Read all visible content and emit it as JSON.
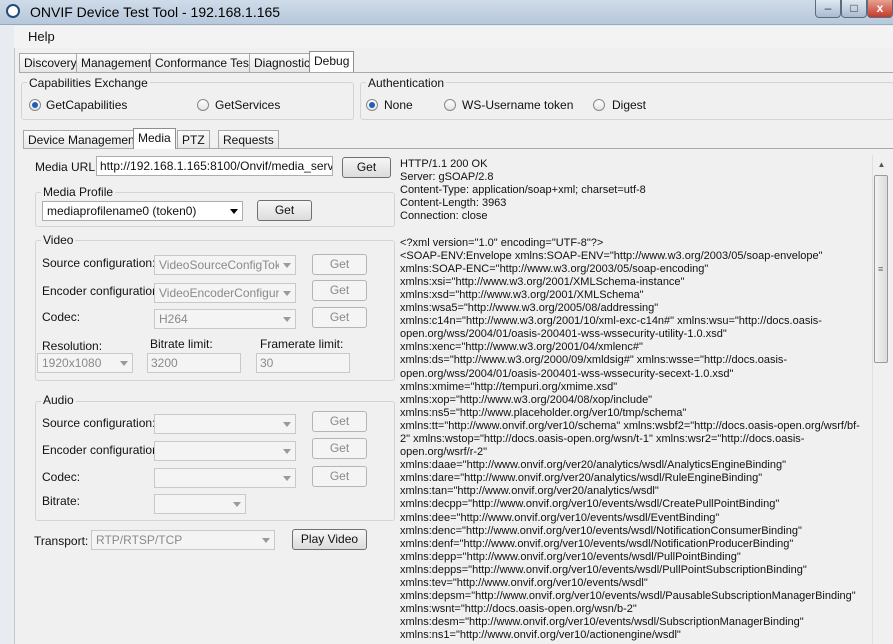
{
  "window": {
    "title": "ONVIF Device Test Tool - 192.168.1.165",
    "close_glyph": "x"
  },
  "menu": {
    "help": "Help"
  },
  "main_tabs": [
    "Discovery",
    "Management",
    "Conformance Test",
    "Diagnostic",
    "Debug"
  ],
  "capabilities": {
    "group_label": "Capabilities Exchange",
    "option_getcapabilities": "GetCapabilities",
    "option_getservices": "GetServices",
    "selected": "GetCapabilities"
  },
  "authentication": {
    "group_label": "Authentication",
    "option_none": "None",
    "option_ws_username": "WS-Username token",
    "option_digest": "Digest",
    "selected": "None"
  },
  "sub_tabs": [
    "Device Management",
    "Media",
    "PTZ",
    "Requests"
  ],
  "media": {
    "url_label": "Media URL:",
    "url_value": "http://192.168.1.165:8100/Onvif/media_service",
    "get_label": "Get",
    "profile": {
      "group_label": "Media Profile",
      "selected": "mediaprofilename0 (token0)",
      "get_label": "Get"
    },
    "video": {
      "group_label": "Video",
      "source_label": "Source configuration:",
      "source_value": "VideoSourceConfigToken",
      "encoder_label": "Encoder configuration:",
      "encoder_value": "VideoEncoderConfiguration",
      "codec_label": "Codec:",
      "codec_value": "H264",
      "get_label": "Get",
      "resolution_label": "Resolution:",
      "resolution_value": "1920x1080",
      "bitrate_label": "Bitrate limit:",
      "bitrate_value": "3200",
      "framerate_label": "Framerate limit:",
      "framerate_value": "30"
    },
    "audio": {
      "group_label": "Audio",
      "source_label": "Source configuration:",
      "encoder_label": "Encoder configuration:",
      "codec_label": "Codec:",
      "bitrate_label": "Bitrate:",
      "get_label": "Get"
    },
    "transport_label": "Transport:",
    "transport_value": "RTP/RTSP/TCP",
    "play_label": "Play Video"
  },
  "response_text": "HTTP/1.1 200 OK\nServer: gSOAP/2.8\nContent-Type: application/soap+xml; charset=utf-8\nContent-Length: 3963\nConnection: close\n\n<?xml version=\"1.0\" encoding=\"UTF-8\"?>\n<SOAP-ENV:Envelope xmlns:SOAP-ENV=\"http://www.w3.org/2003/05/soap-envelope\"\nxmlns:SOAP-ENC=\"http://www.w3.org/2003/05/soap-encoding\"\nxmlns:xsi=\"http://www.w3.org/2001/XMLSchema-instance\"\nxmlns:xsd=\"http://www.w3.org/2001/XMLSchema\"\nxmlns:wsa5=\"http://www.w3.org/2005/08/addressing\"\nxmlns:c14n=\"http://www.w3.org/2001/10/xml-exc-c14n#\" xmlns:wsu=\"http://docs.oasis-\nopen.org/wss/2004/01/oasis-200401-wss-wssecurity-utility-1.0.xsd\"\nxmlns:xenc=\"http://www.w3.org/2001/04/xmlenc#\"\nxmlns:ds=\"http://www.w3.org/2000/09/xmldsig#\" xmlns:wsse=\"http://docs.oasis-\nopen.org/wss/2004/01/oasis-200401-wss-wssecurity-secext-1.0.xsd\"\nxmlns:xmime=\"http://tempuri.org/xmime.xsd\"\nxmlns:xop=\"http://www.w3.org/2004/08/xop/include\"\nxmlns:ns5=\"http://www.placeholder.org/ver10/tmp/schema\"\nxmlns:tt=\"http://www.onvif.org/ver10/schema\" xmlns:wsbf2=\"http://docs.oasis-open.org/wsrf/bf-\n2\" xmlns:wstop=\"http://docs.oasis-open.org/wsn/t-1\" xmlns:wsr2=\"http://docs.oasis-\nopen.org/wsrf/r-2\"\nxmlns:daae=\"http://www.onvif.org/ver20/analytics/wsdl/AnalyticsEngineBinding\"\nxmlns:dare=\"http://www.onvif.org/ver20/analytics/wsdl/RuleEngineBinding\"\nxmlns:tan=\"http://www.onvif.org/ver20/analytics/wsdl\"\nxmlns:decpp=\"http://www.onvif.org/ver10/events/wsdl/CreatePullPointBinding\"\nxmlns:dee=\"http://www.onvif.org/ver10/events/wsdl/EventBinding\"\nxmlns:denc=\"http://www.onvif.org/ver10/events/wsdl/NotificationConsumerBinding\"\nxmlns:denf=\"http://www.onvif.org/ver10/events/wsdl/NotificationProducerBinding\"\nxmlns:depp=\"http://www.onvif.org/ver10/events/wsdl/PullPointBinding\"\nxmlns:depps=\"http://www.onvif.org/ver10/events/wsdl/PullPointSubscriptionBinding\"\nxmlns:tev=\"http://www.onvif.org/ver10/events/wsdl\"\nxmlns:depsm=\"http://www.onvif.org/ver10/events/wsdl/PausableSubscriptionManagerBinding\"\nxmlns:wsnt=\"http://docs.oasis-open.org/wsn/b-2\"\nxmlns:desm=\"http://www.onvif.org/ver10/events/wsdl/SubscriptionManagerBinding\"\nxmlns:ns1=\"http://www.onvif.org/ver10/actionengine/wsdl\""
}
